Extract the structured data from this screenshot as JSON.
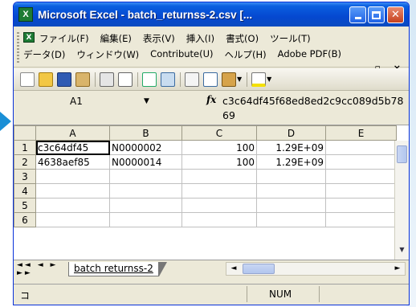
{
  "window": {
    "app_icon": "X",
    "title": "Microsoft Excel - batch_returnss-2.csv  [...",
    "minimize_icon": "minimize-icon",
    "maximize_icon": "maximize-icon",
    "close_icon": "close-icon",
    "close_glyph": "✕"
  },
  "menubar": {
    "row1": [
      "ファイル(F)",
      "編集(E)",
      "表示(V)",
      "挿入(I)",
      "書式(O)",
      "ツール(T)"
    ],
    "row2": [
      "データ(D)",
      "ウィンドウ(W)",
      "Contribute(U)",
      "ヘルプ(H)",
      "Adobe PDF(B)"
    ],
    "mdi_controls": "_ ▫ ×"
  },
  "toolbar": {
    "icons": [
      "new-icon",
      "open-icon",
      "save-icon",
      "permission-icon",
      "print-icon",
      "print-preview-icon",
      "spelling-icon",
      "research-icon",
      "cut-icon",
      "copy-icon",
      "paste-icon",
      "fill-color-icon"
    ]
  },
  "formula_bar": {
    "name_box": "A1",
    "fx": "fx",
    "content": "c3c64df45f68ed8ed2c9cc089d5b7869"
  },
  "sheet": {
    "columns": [
      "A",
      "B",
      "C",
      "D",
      "E"
    ],
    "rows": [
      {
        "num": "1",
        "cells": [
          "c3c64df45",
          "N0000002",
          "100",
          "1.29E+09",
          ""
        ]
      },
      {
        "num": "2",
        "cells": [
          "4638aef85",
          "N0000014",
          "100",
          "1.29E+09",
          ""
        ]
      },
      {
        "num": "3",
        "cells": [
          "",
          "",
          "",
          "",
          ""
        ]
      },
      {
        "num": "4",
        "cells": [
          "",
          "",
          "",
          "",
          ""
        ]
      },
      {
        "num": "5",
        "cells": [
          "",
          "",
          "",
          "",
          ""
        ]
      },
      {
        "num": "6",
        "cells": [
          "",
          "",
          "",
          "",
          ""
        ]
      }
    ]
  },
  "tabs": {
    "nav": "◄◄ ◄ ► ►►",
    "sheet_name": "batch returnss-2"
  },
  "status": {
    "ready": "コ",
    "num": "NUM"
  },
  "colors": {
    "title_bar": "#0548d0",
    "active_header": "#f7c86b",
    "pointer": "#1a8fd6"
  }
}
